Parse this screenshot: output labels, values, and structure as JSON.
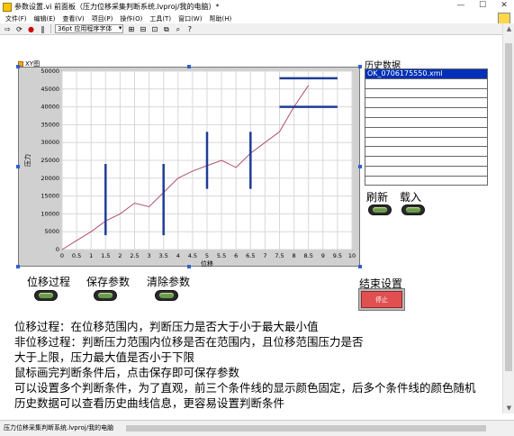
{
  "window": {
    "title": "参数设置.vi 前面板（压力位移采集判断系统.lvproj/我的电脑）*",
    "controls": [
      "—",
      "☐",
      "✕"
    ]
  },
  "menu": {
    "items": [
      "文件(F)",
      "编辑(E)",
      "查看(V)",
      "项目(P)",
      "操作(O)",
      "工具(T)",
      "窗口(W)",
      "帮助(H)"
    ]
  },
  "toolbar": {
    "font_selector": "36pt 应用程序字体"
  },
  "graph": {
    "label": "XY图",
    "plot_bg": "#ffffff",
    "curve_color": "#b0506a",
    "marker_color": "#1f3c96"
  },
  "chart_data": {
    "type": "line",
    "xlabel": "位移",
    "ylabel": "压力",
    "xlim": [
      0,
      10
    ],
    "ylim": [
      0,
      50000
    ],
    "x_ticks": [
      "0",
      "0.5",
      "1",
      "1.5",
      "2",
      "2.5",
      "3",
      "3.5",
      "4",
      "4.5",
      "5",
      "5.5",
      "6",
      "6.5",
      "7",
      "7.5",
      "8",
      "8.5",
      "9",
      "9.5",
      "10"
    ],
    "y_ticks": [
      "0",
      "5000",
      "10000",
      "15000",
      "20000",
      "25000",
      "30000",
      "35000",
      "40000",
      "45000",
      "50000"
    ],
    "grid": true,
    "series": [
      {
        "x": [
          0,
          0.5,
          1,
          1.5,
          2,
          2.5,
          3,
          3.5,
          4,
          4.5,
          5,
          5.5,
          6,
          6.5,
          7,
          7.5,
          8,
          8.5
        ],
        "y": [
          0,
          2500,
          5000,
          8000,
          10000,
          13000,
          12000,
          16000,
          20000,
          22000,
          23500,
          25000,
          23000,
          27000,
          30000,
          33000,
          40000,
          46000
        ]
      }
    ],
    "condition_lines": [
      {
        "orientation": "vertical",
        "x": 1.5,
        "y0": 4000,
        "y1": 24000
      },
      {
        "orientation": "vertical",
        "x": 3.5,
        "y0": 4000,
        "y1": 24000
      },
      {
        "orientation": "vertical",
        "x": 5,
        "y0": 17000,
        "y1": 33000
      },
      {
        "orientation": "vertical",
        "x": 6.5,
        "y0": 17000,
        "y1": 33000
      },
      {
        "orientation": "horizontal",
        "y": 48000,
        "x0": 7.5,
        "x1": 9.5
      },
      {
        "orientation": "horizontal",
        "y": 40000,
        "x0": 7.5,
        "x1": 9.5
      }
    ]
  },
  "history": {
    "label": "历史数据",
    "items": [
      "OK_0706175550.xml",
      "",
      "",
      "",
      "",
      "",
      "",
      "",
      "",
      "",
      "",
      ""
    ]
  },
  "buttons": {
    "refresh": "刷新",
    "load": "载入",
    "displacement_process": "位移过程",
    "save_params": "保存参数",
    "clear_params": "清除参数",
    "end_settings": "结束设置",
    "stop": "停止"
  },
  "description": [
    "位移过程：在位移范围内，判断压力是否大于小于最大最小值",
    "非位移过程：判断压力范围内位移是否在范围内，且位移范围压力是否",
    "大于上限，压力最大值是否小于下限",
    "鼠标画完判断条件后，点击保存即可保存参数",
    "可以设置多个判断条件，为了直观，前三个条件线的显示颜色固定，后多个条件线的颜色随机",
    "历史数据可以查看历史曲线信息，更容易设置判断条件"
  ],
  "statusbar": {
    "path": "压力位移采集判断系统.lvproj/我的电脑"
  }
}
